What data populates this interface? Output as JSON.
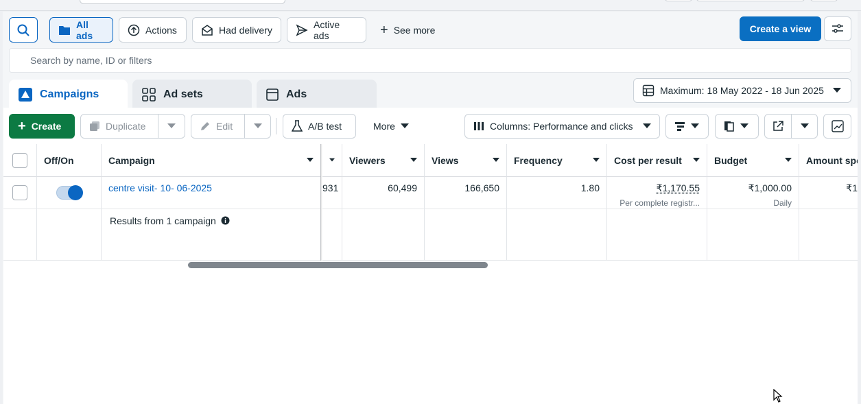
{
  "toolbar": {
    "all_ads": "All ads",
    "actions": "Actions",
    "had_delivery": "Had delivery",
    "active_ads": "Active ads",
    "see_more": "See more",
    "create_view": "Create a view"
  },
  "search": {
    "placeholder": "Search by name, ID or filters"
  },
  "tabs": [
    {
      "label": "Campaigns",
      "active": true
    },
    {
      "label": "Ad sets",
      "active": false
    },
    {
      "label": "Ads",
      "active": false
    }
  ],
  "date_range": "Maximum: 18 May 2022 - 18 Jun 2025",
  "actions_bar": {
    "create": "Create",
    "duplicate": "Duplicate",
    "edit": "Edit",
    "ab_test": "A/B test",
    "more": "More",
    "columns": "Columns: Performance and clicks"
  },
  "table": {
    "headers": {
      "off_on": "Off/On",
      "campaign": "Campaign",
      "viewers": "Viewers",
      "views": "Views",
      "frequency": "Frequency",
      "cost_per_result": "Cost per result",
      "budget": "Budget",
      "amount_spent": "Amount spe"
    },
    "row": {
      "campaign_name": "centre visit- 10- 06-2025",
      "toggle_on": true,
      "partial_value": "931",
      "viewers": "60,499",
      "views": "166,650",
      "frequency": "1.80",
      "cost_per_result": "₹1,170.55",
      "cost_per_result_sub": "Per complete registr...",
      "budget": "₹1,000.00",
      "budget_sub": "Daily",
      "amount_spent": "₹1"
    },
    "footer": {
      "results_label": "Results from 1 campaign"
    }
  },
  "colors": {
    "accent": "#0a66c2",
    "create_green": "#0c7a43"
  }
}
